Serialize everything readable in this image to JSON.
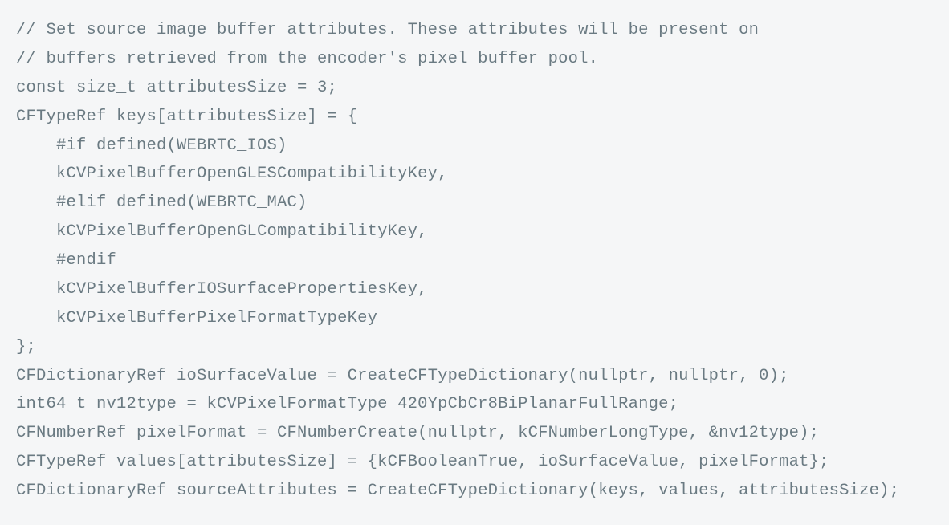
{
  "code": {
    "lines": [
      "// Set source image buffer attributes. These attributes will be present on",
      "// buffers retrieved from the encoder's pixel buffer pool.",
      "const size_t attributesSize = 3;",
      "CFTypeRef keys[attributesSize] = {",
      "    #if defined(WEBRTC_IOS)",
      "    kCVPixelBufferOpenGLESCompatibilityKey,",
      "    #elif defined(WEBRTC_MAC)",
      "    kCVPixelBufferOpenGLCompatibilityKey,",
      "    #endif",
      "    kCVPixelBufferIOSurfacePropertiesKey,",
      "    kCVPixelBufferPixelFormatTypeKey",
      "};",
      "CFDictionaryRef ioSurfaceValue = CreateCFTypeDictionary(nullptr, nullptr, 0);",
      "int64_t nv12type = kCVPixelFormatType_420YpCbCr8BiPlanarFullRange;",
      "CFNumberRef pixelFormat = CFNumberCreate(nullptr, kCFNumberLongType, &nv12type);",
      "CFTypeRef values[attributesSize] = {kCFBooleanTrue, ioSurfaceValue, pixelFormat};",
      "CFDictionaryRef sourceAttributes = CreateCFTypeDictionary(keys, values, attributesSize);"
    ]
  }
}
